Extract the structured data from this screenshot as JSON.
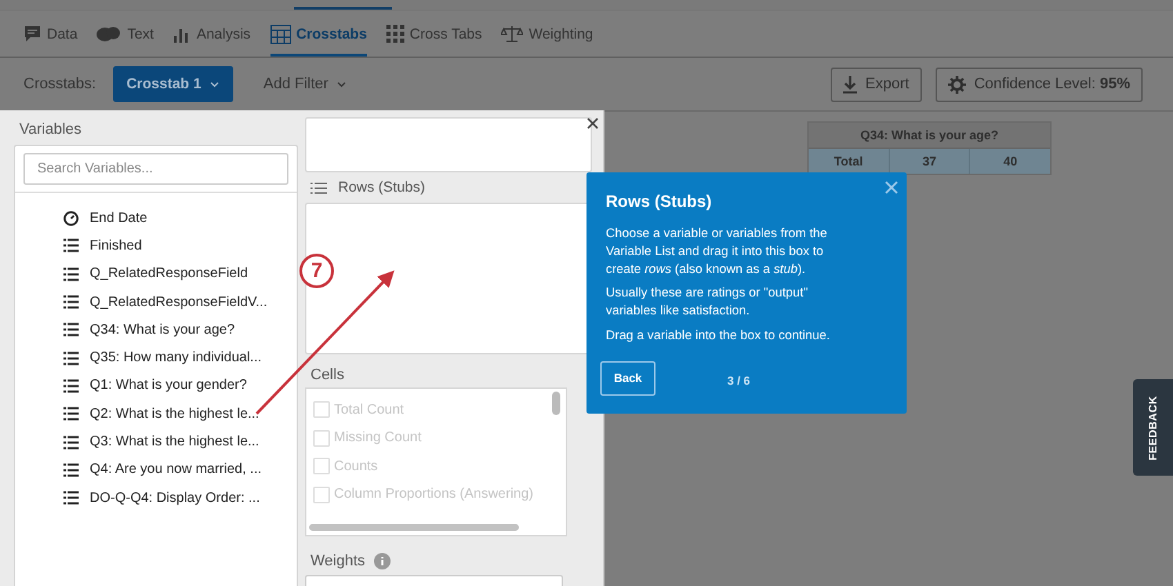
{
  "nav_tabs": [
    {
      "label": "Data",
      "selected": false
    },
    {
      "label": "Text",
      "selected": false
    },
    {
      "label": "Analysis",
      "selected": false
    },
    {
      "label": "Crosstabs",
      "selected": true
    },
    {
      "label": "Cross Tabs",
      "selected": false
    },
    {
      "label": "Weighting",
      "selected": false
    }
  ],
  "toolbar": {
    "label": "Crosstabs:",
    "crosstab": "Crosstab 1",
    "filter": "Add Filter",
    "export": "Export",
    "confidence": "Confidence Level: **95%**"
  },
  "table": {
    "title": "Q34: What is your age?",
    "cells": [
      "Total",
      "37",
      "40"
    ]
  },
  "variables": {
    "title": "Variables",
    "search_placeholder": "Search Variables...",
    "items": [
      {
        "label": "End Date",
        "kind": "date"
      },
      {
        "label": "Finished",
        "kind": "list"
      },
      {
        "label": "Q_RelatedResponseField",
        "kind": "list"
      },
      {
        "label": "Q_RelatedResponseFieldV...",
        "kind": "list"
      },
      {
        "label": "Q34: What is your age?",
        "kind": "list"
      },
      {
        "label": "Q35: How many individual...",
        "kind": "list"
      },
      {
        "label": "Q1: What is your gender?",
        "kind": "list"
      },
      {
        "label": "Q2: What is the highest le...",
        "kind": "list"
      },
      {
        "label": "Q3: What is the highest le...",
        "kind": "list"
      },
      {
        "label": "Q4: Are you now married, ...",
        "kind": "list"
      },
      {
        "label": "DO-Q-Q4: Display Order: ...",
        "kind": "list"
      }
    ]
  },
  "rows_section": {
    "title": "Rows (Stubs)"
  },
  "cells": {
    "title": "Cells",
    "disabled": true,
    "items": [
      {
        "label": "Total Count",
        "checked": false
      },
      {
        "label": "Missing Count",
        "checked": false
      },
      {
        "label": "Counts",
        "checked": false
      },
      {
        "label": "Column Proportions (Answering)",
        "checked": false
      }
    ]
  },
  "weights": {
    "title": "Weights"
  },
  "popover": {
    "title": "Rows (Stubs)",
    "paragraphs": [
      "Choose a variable or variables from the Variable List and drag it into this box to create *rows* (also known as a *stub*).",
      "Usually these are ratings or \"output\" variables like satisfaction.",
      "Drag a variable into the box to continue."
    ],
    "back": "Back",
    "step": "3 / 6"
  },
  "annotation": {
    "number": "7"
  },
  "feedback": "FEEDBACK"
}
